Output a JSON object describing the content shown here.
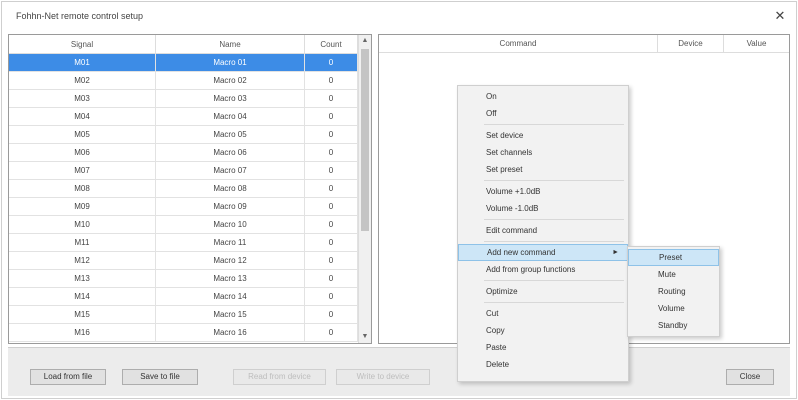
{
  "window": {
    "title": "Fohhn-Net remote control setup",
    "close_glyph": "✕"
  },
  "signals": {
    "headers": {
      "signal": "Signal",
      "name": "Name",
      "count": "Count"
    },
    "rows": [
      {
        "signal": "M01",
        "name": "Macro 01",
        "count": "0",
        "selected": true
      },
      {
        "signal": "M02",
        "name": "Macro 02",
        "count": "0"
      },
      {
        "signal": "M03",
        "name": "Macro 03",
        "count": "0"
      },
      {
        "signal": "M04",
        "name": "Macro 04",
        "count": "0"
      },
      {
        "signal": "M05",
        "name": "Macro 05",
        "count": "0"
      },
      {
        "signal": "M06",
        "name": "Macro 06",
        "count": "0"
      },
      {
        "signal": "M07",
        "name": "Macro 07",
        "count": "0"
      },
      {
        "signal": "M08",
        "name": "Macro 08",
        "count": "0"
      },
      {
        "signal": "M09",
        "name": "Macro 09",
        "count": "0"
      },
      {
        "signal": "M10",
        "name": "Macro 10",
        "count": "0"
      },
      {
        "signal": "M11",
        "name": "Macro 11",
        "count": "0"
      },
      {
        "signal": "M12",
        "name": "Macro 12",
        "count": "0"
      },
      {
        "signal": "M13",
        "name": "Macro 13",
        "count": "0"
      },
      {
        "signal": "M14",
        "name": "Macro 14",
        "count": "0"
      },
      {
        "signal": "M15",
        "name": "Macro 15",
        "count": "0"
      },
      {
        "signal": "M16",
        "name": "Macro 16",
        "count": "0"
      }
    ]
  },
  "commands": {
    "headers": {
      "command": "Command",
      "device": "Device",
      "value": "Value"
    }
  },
  "context_menu": {
    "items": [
      {
        "label": "On"
      },
      {
        "label": "Off"
      },
      {
        "sep": true
      },
      {
        "label": "Set device"
      },
      {
        "label": "Set channels"
      },
      {
        "label": "Set preset"
      },
      {
        "sep": true
      },
      {
        "label": "Volume +1.0dB"
      },
      {
        "label": "Volume -1.0dB"
      },
      {
        "sep": true
      },
      {
        "label": "Edit command"
      },
      {
        "sep": true
      },
      {
        "label": "Add new command",
        "highlighted": true,
        "submenu": true
      },
      {
        "label": "Add from group functions"
      },
      {
        "sep": true
      },
      {
        "label": "Optimize"
      },
      {
        "sep": true
      },
      {
        "label": "Cut"
      },
      {
        "label": "Copy"
      },
      {
        "label": "Paste"
      },
      {
        "label": "Delete"
      }
    ],
    "submenu_arrow": "►"
  },
  "submenu": {
    "items": [
      {
        "label": "Preset",
        "highlighted": true
      },
      {
        "label": "Mute"
      },
      {
        "label": "Routing"
      },
      {
        "label": "Volume"
      },
      {
        "label": "Standby"
      }
    ]
  },
  "buttons": {
    "load": "Load from file",
    "save": "Save to file",
    "read": "Read from device",
    "write": "Write to device",
    "close": "Close"
  },
  "colors": {
    "selection": "#3d8ce6",
    "menu_highlight": "#cde6f7"
  }
}
